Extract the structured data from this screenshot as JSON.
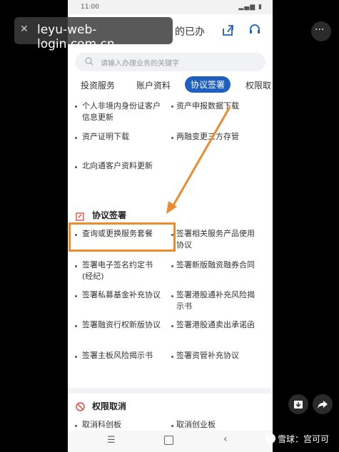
{
  "status_bar": {
    "time": "11:00"
  },
  "header": {
    "partial_text": "的已办"
  },
  "watermark": {
    "text": "leyu-web-login.com.cn"
  },
  "search": {
    "placeholder": "请输入办理业务的关键字"
  },
  "tabs": [
    {
      "label": "投资服务",
      "active": false
    },
    {
      "label": "账户资料",
      "active": false
    },
    {
      "label": "协议签署",
      "active": true
    },
    {
      "label": "权限取",
      "active": false
    }
  ],
  "account_items": {
    "col1": [
      "个人非境内身份证客户信息更新",
      "资产证明下载",
      "北向通客户资料更新"
    ],
    "col2": [
      "资产申报数据下载",
      "两融变更三方存管"
    ]
  },
  "agreement_section": {
    "title": "协议签署",
    "col1": [
      "查询或更换服务套餐",
      "签署电子签名约定书(经纪)",
      "签署私募基金补充协议",
      "签署融资行权新版协议",
      "签署主板风险揭示书"
    ],
    "col2": [
      "签署相关服务产品使用协议",
      "签署新版融资融券合同",
      "签署港股通补充风险揭示书",
      "签署港股通卖出承诺函",
      "签署资管补充协议"
    ]
  },
  "revoke_section": {
    "title": "权限取消",
    "col1": [
      "取消科创板"
    ],
    "col2": [
      "取消创业板"
    ]
  },
  "brand": {
    "text": "雪球：宫可可"
  },
  "colors": {
    "accent": "#1f5fbf",
    "highlight": "#ef8a2d",
    "section_icon": "#e0443a"
  }
}
